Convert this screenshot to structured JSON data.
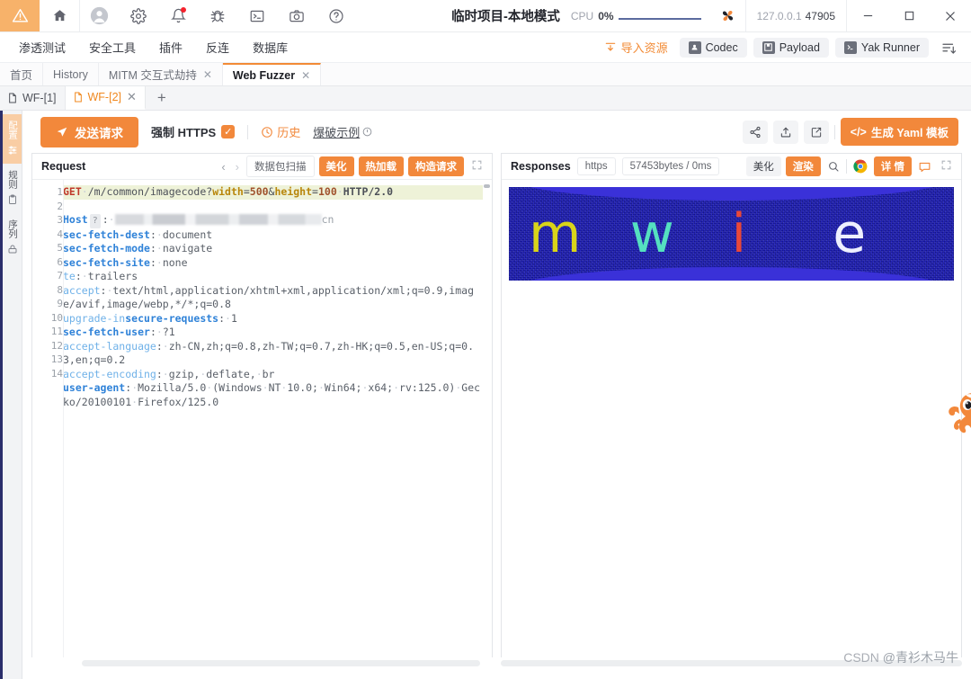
{
  "titlebar": {
    "icons": [
      {
        "name": "warning-triangle-icon"
      },
      {
        "name": "home-icon"
      },
      {
        "name": "user-avatar-icon"
      },
      {
        "name": "gear-icon"
      },
      {
        "name": "bell-icon"
      },
      {
        "name": "bug-icon"
      },
      {
        "name": "terminal-icon"
      },
      {
        "name": "camera-icon"
      },
      {
        "name": "help-icon"
      }
    ],
    "project_title": "临时项目-本地模式",
    "cpu_label": "CPU",
    "cpu_value": "0%",
    "address_host": "127.0.0.1",
    "address_port": "47905",
    "minimize": "—",
    "maximize": "▢",
    "close": "✕"
  },
  "menubar": {
    "items": [
      "渗透测试",
      "安全工具",
      "插件",
      "反连",
      "数据库"
    ],
    "import_label": "导入资源",
    "codec_label": "Codec",
    "payload_label": "Payload",
    "yak_runner_label": "Yak Runner",
    "list_icon": "list-order-icon"
  },
  "page_tabs": [
    {
      "label": "首页",
      "active": false,
      "closable": false
    },
    {
      "label": "History",
      "active": false,
      "closable": false
    },
    {
      "label": "MITM 交互式劫持",
      "active": false,
      "closable": true
    },
    {
      "label": "Web Fuzzer",
      "active": true,
      "closable": true
    }
  ],
  "sub_tabs": [
    {
      "label": "WF-[1]",
      "active": false,
      "closable": false
    },
    {
      "label": "WF-[2]",
      "active": true,
      "closable": true
    }
  ],
  "sub_tab_add": "+",
  "rail": [
    {
      "label": "配置",
      "icon": "config-icon",
      "active": true
    },
    {
      "label": "规则",
      "icon": "clipboard-icon",
      "active": false
    },
    {
      "label": "序列",
      "icon": "sequence-icon",
      "active": false
    }
  ],
  "fuzz_toolbar": {
    "send_label": "发送请求",
    "https_label": "强制 HTTPS",
    "https_checked": true,
    "history_label": "历史",
    "boom_label": "爆破示例",
    "share_icon": "share-icon",
    "export_icon": "upload-icon",
    "edit_icon": "edit-square-icon",
    "yaml_label": "生成 Yaml 模板",
    "yaml_prefix": "</>"
  },
  "request_pane": {
    "title": "Request",
    "prev_arrow": "‹",
    "next_arrow": "›",
    "scan_label": "数据包扫描",
    "beautify_label": "美化",
    "hotload_label": "热加载",
    "construct_label": "构造请求",
    "expand_icon": "expand-icon",
    "line_numbers": [
      1,
      2,
      3,
      4,
      5,
      6,
      7,
      8,
      9,
      10,
      11,
      12,
      13,
      14
    ],
    "request_lines": {
      "method": "GET",
      "path": "/m/common/imagecode?",
      "param1_key": "width",
      "param1_val": "500",
      "amp": "&",
      "param2_key": "height",
      "param2_val": "100",
      "protocol": "HTTP/2.0",
      "host_key": "Host",
      "host_hint": "?",
      "host_tail": "cn",
      "headers": [
        {
          "key": "sec-fetch-dest",
          "value": "document"
        },
        {
          "key": "sec-fetch-mode",
          "value": "navigate"
        },
        {
          "key": "sec-fetch-site",
          "value": "none"
        },
        {
          "key": "te",
          "value": "trailers"
        },
        {
          "key": "accept",
          "value": "text/html,application/xhtml+xml,application/xml;q=0.9,image/avif,image/webp,*/*;q=0.8"
        },
        {
          "key": "upgrade-insecure-requests",
          "value": "1"
        },
        {
          "key": "sec-fetch-user",
          "value": "?1"
        },
        {
          "key": "accept-language",
          "value": "zh-CN,zh;q=0.8,zh-TW;q=0.7,zh-HK;q=0.5,en-US;q=0.3,en;q=0.2"
        },
        {
          "key": "accept-encoding",
          "value": "gzip, deflate, br"
        },
        {
          "key": "user-agent",
          "value": "Mozilla/5.0 (Windows NT 10.0; Win64; x64; rv:125.0) Gecko/20100101 Firefox/125.0"
        }
      ]
    }
  },
  "response_pane": {
    "title": "Responses",
    "scheme_chip": "https",
    "size_chip": "57453bytes / 0ms",
    "beautify_label": "美化",
    "render_label": "渲染",
    "search_icon": "search-icon",
    "chrome_icon": "chrome-icon",
    "detail_label": "详 情",
    "comment_icon": "comment-icon",
    "expand_icon": "expand-icon",
    "captcha": {
      "characters": [
        {
          "char": "m",
          "color": "#d9d419"
        },
        {
          "char": "w",
          "color": "#55e0c0"
        },
        {
          "char": "i",
          "color": "#e8483a"
        },
        {
          "char": "e",
          "color": "#eef0ff"
        }
      ],
      "background_color": "#1a1ab4",
      "wave_color": "#3a31d8"
    }
  },
  "mascot": {
    "name": "yakit-mascot",
    "color": "#f2883b"
  },
  "watermark": {
    "prefix": "CSDN ",
    "handle": "@青衫木马牛"
  }
}
